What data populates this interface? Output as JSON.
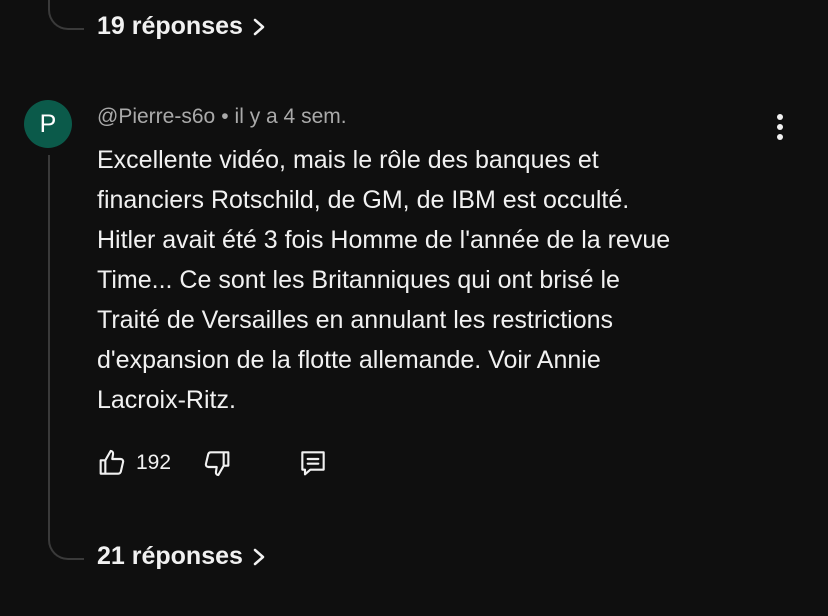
{
  "thread": {
    "previous_replies_label": "19 réponses",
    "next_replies_label": "21 réponses"
  },
  "comment": {
    "avatar_initial": "P",
    "author": "@Pierre-s6o",
    "separator": "•",
    "time": "il y a 4 sem.",
    "text_lines": [
      "Excellente vidéo, mais le rôle des banques et",
      "financiers Rotschild, de GM, de IBM est occulté.",
      "Hitler avait été 3 fois Homme de l'année de la revue",
      "Time... Ce sont les Britanniques qui ont brisé le",
      "Traité de Versailles en annulant les restrictions",
      "d'expansion de la flotte allemande. Voir Annie",
      "Lacroix-Ritz."
    ],
    "likes": "192"
  },
  "icons": {
    "like": "thumbs-up-icon",
    "dislike": "thumbs-down-icon",
    "reply": "comment-icon",
    "more": "more-vertical-icon",
    "chevron": "chevron-right-icon"
  },
  "colors": {
    "background": "#0f0f0f",
    "text": "#f1f1f1",
    "secondary_text": "#aaaaaa",
    "avatar_bg": "#0b5a4a",
    "thread_line": "#3a3a3a"
  }
}
